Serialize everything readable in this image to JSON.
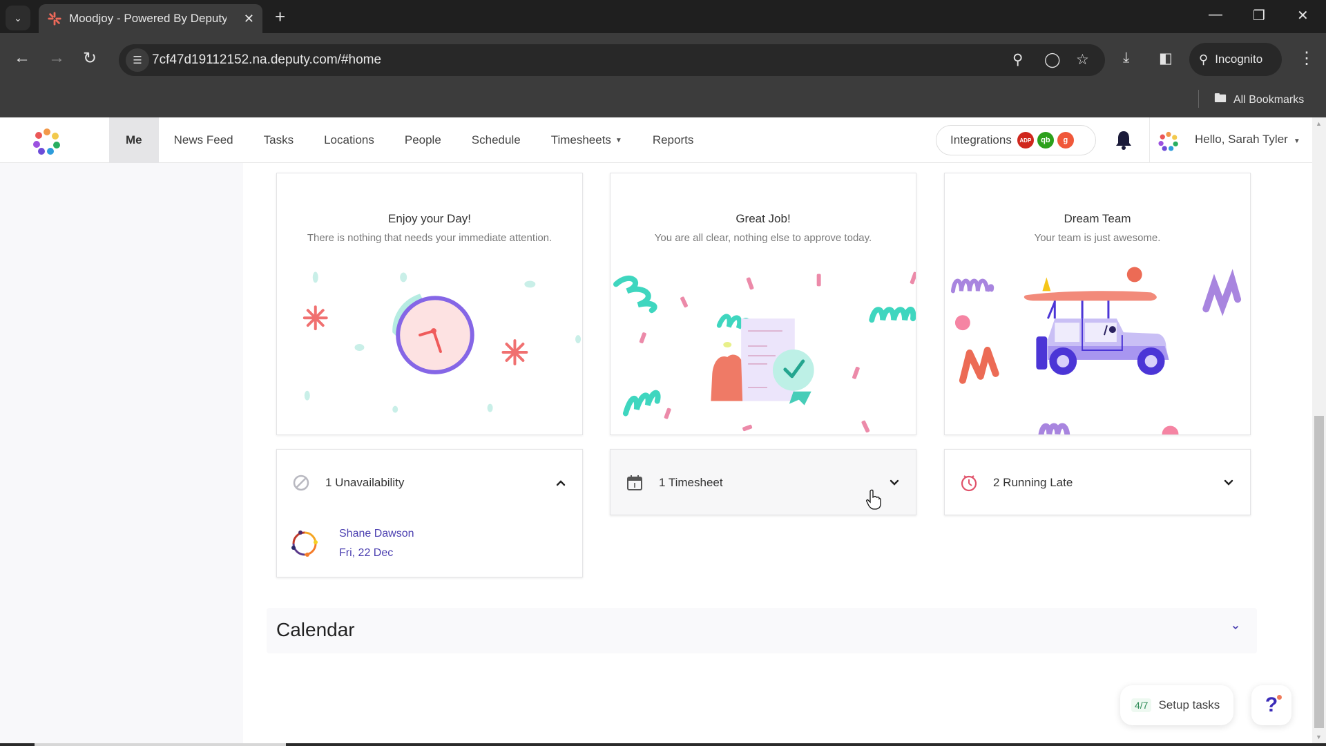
{
  "browser": {
    "tab_title": "Moodjoy - Powered By Deputy",
    "url": "7cf47d19112152.na.deputy.com/#home",
    "incognito_label": "Incognito",
    "bookmarks_label": "All Bookmarks",
    "icons": [
      "tab-list-icon",
      "close-icon",
      "new-tab-icon",
      "minimize-icon",
      "restore-icon",
      "window-close-icon",
      "back-icon",
      "forward-icon",
      "reload-icon",
      "site-info-icon",
      "zoom-icon",
      "eye-off-icon",
      "star-icon",
      "download-icon",
      "side-panel-icon",
      "incognito-icon",
      "more-icon",
      "folder-icon"
    ]
  },
  "header": {
    "nav": [
      {
        "label": "Me",
        "active": true
      },
      {
        "label": "News Feed"
      },
      {
        "label": "Tasks"
      },
      {
        "label": "Locations"
      },
      {
        "label": "People"
      },
      {
        "label": "Schedule"
      },
      {
        "label": "Timesheets",
        "dropdown": true
      },
      {
        "label": "Reports"
      }
    ],
    "integrations_label": "Integrations",
    "integration_badges": [
      {
        "text": "ADP",
        "color": "#d0271d"
      },
      {
        "text": "qb",
        "color": "#2ca01c"
      },
      {
        "text": "g",
        "color": "#f0583a"
      }
    ],
    "greeting": "Hello, Sarah Tyler"
  },
  "cards": [
    {
      "title": "Enjoy your Day!",
      "subtitle": "There is nothing that needs your immediate attention.",
      "illustration": "clock-illustration"
    },
    {
      "title": "Great Job!",
      "subtitle": "You are all clear, nothing else to approve today.",
      "illustration": "approval-illustration"
    },
    {
      "title": "Dream Team",
      "subtitle": "Your team is just awesome.",
      "illustration": "jeep-illustration"
    }
  ],
  "accordions": [
    {
      "label": "1 Unavailability",
      "icon": "unavailable-icon",
      "expanded": true,
      "items": [
        {
          "name": "Shane Dawson",
          "date": "Fri, 22 Dec"
        }
      ]
    },
    {
      "label": "1 Timesheet",
      "icon": "calendar-icon",
      "expanded": false
    },
    {
      "label": "2 Running Late",
      "icon": "clock-icon",
      "expanded": false
    }
  ],
  "calendar": {
    "title": "Calendar"
  },
  "setup_tasks": {
    "count": "4/7",
    "label": "Setup tasks"
  },
  "help": {
    "label": "?"
  },
  "colors": {
    "accent": "#4b3fb0",
    "late": "#e0526a",
    "teal": "#3fd6bf"
  }
}
